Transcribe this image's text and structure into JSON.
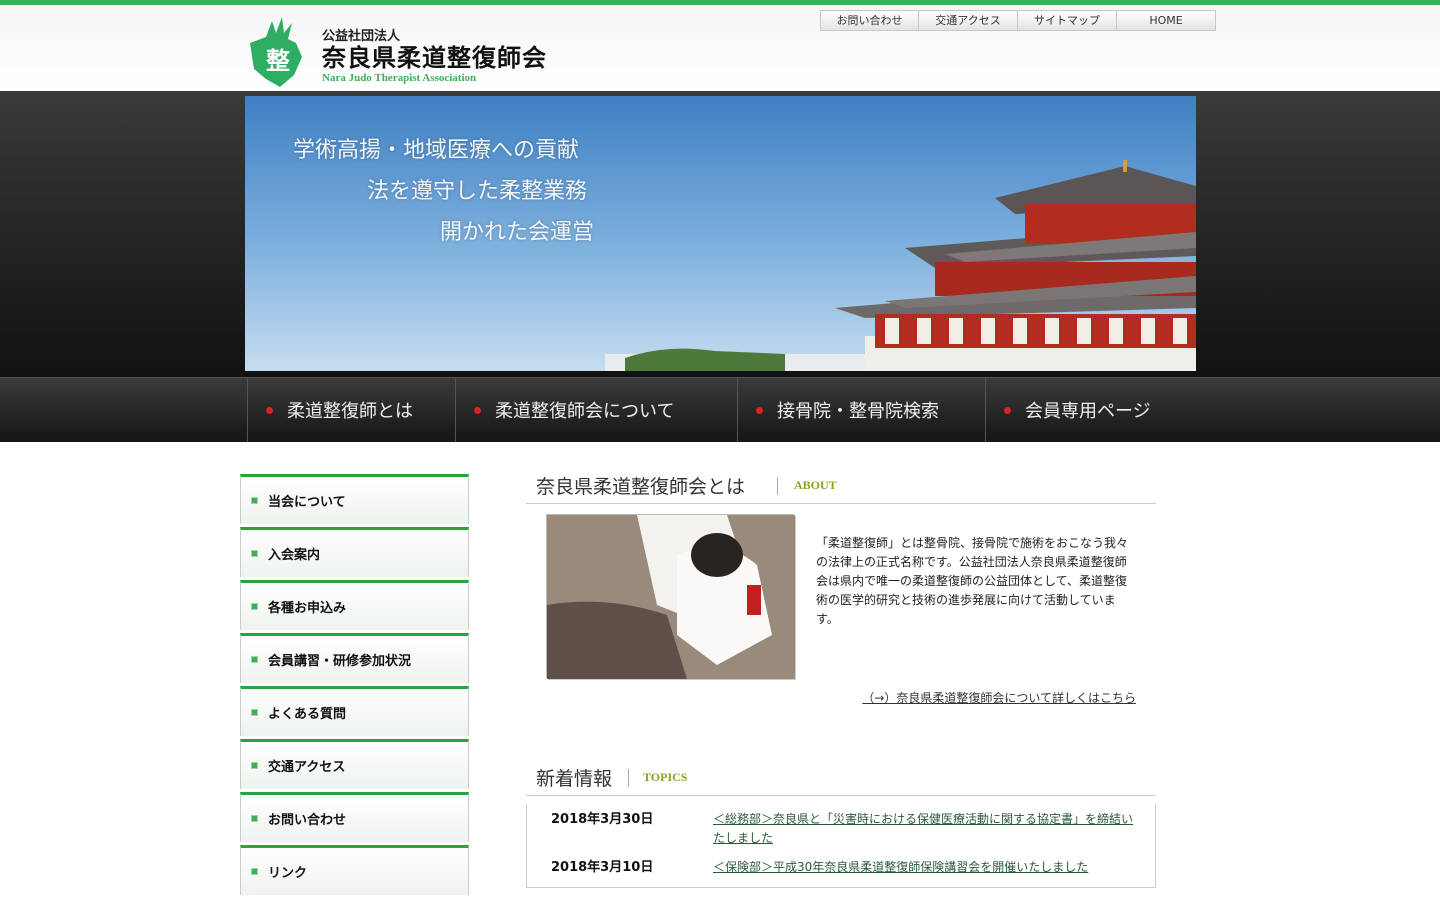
{
  "header": {
    "logo_mark_char": "整",
    "logo_sub": "公益社団法人",
    "logo_main": "奈良県柔道整復師会",
    "logo_en": "Nara Judo Therapist Association",
    "utility_links": [
      "お問い合わせ",
      "交通アクセス",
      "サイトマップ",
      "HOME"
    ]
  },
  "hero": {
    "lines": [
      "学術高揚・地域医療への貢献",
      "法を遵守した柔整業務",
      "開かれた会運営"
    ]
  },
  "nav": {
    "items": [
      "柔道整復師とは",
      "柔道整復師会について",
      "接骨院・整骨院検索",
      "会員専用ページ"
    ]
  },
  "sidebar": {
    "items": [
      "当会について",
      "入会案内",
      "各種お申込み",
      "会員講習・研修参加状況",
      "よくある質問",
      "交通アクセス",
      "お問い合わせ",
      "リンク"
    ]
  },
  "about": {
    "title": "奈良県柔道整復師会とは",
    "title_en": "ABOUT",
    "text": "「柔道整復師」とは整骨院、接骨院で施術をおこなう我々の法律上の正式名称です。公益社団法人奈良県柔道整復師会は県内で唯一の柔道整復師の公益団体として、柔道整復術の医学的研究と技術の進歩発展に向けて活動しています。",
    "more_link": "（→）奈良県柔道整復師会について詳しくはこちら"
  },
  "topics": {
    "title": "新着情報",
    "title_en": "TOPICS",
    "items": [
      {
        "date": "2018年3月30日",
        "text": "＜総務部＞奈良県と「災害時における保健医療活動に関する協定書」を締結いたしました"
      },
      {
        "date": "2018年3月10日",
        "text": "＜保険部＞平成30年奈良県柔道整復師保険講習会を開催いたしました"
      }
    ]
  },
  "colors": {
    "accent": "#3fae5b",
    "nav_dot": "#dd2222",
    "topics_en": "#8aa51a"
  }
}
